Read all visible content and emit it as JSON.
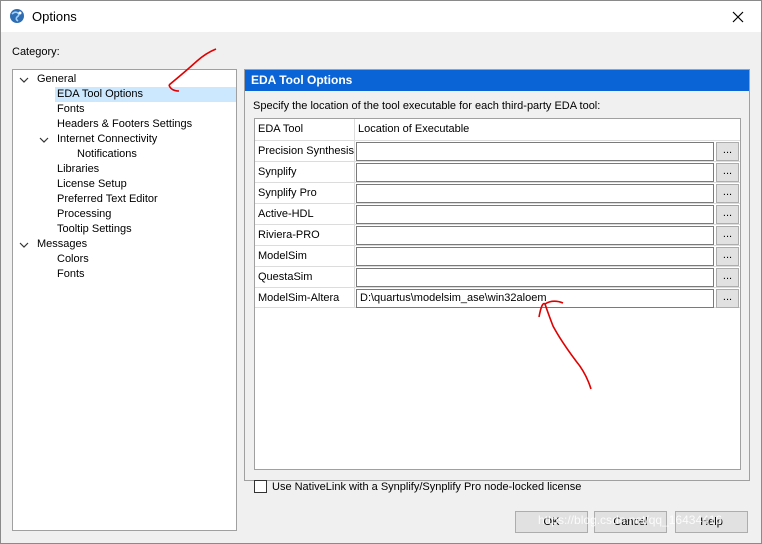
{
  "window": {
    "title": "Options"
  },
  "category_label": "Category:",
  "tree": {
    "items": [
      {
        "label": "General",
        "expanded": true
      },
      {
        "label": "EDA Tool Options",
        "selected": true
      },
      {
        "label": "Fonts"
      },
      {
        "label": "Headers & Footers Settings"
      },
      {
        "label": "Internet Connectivity",
        "expanded": true
      },
      {
        "label": "Notifications"
      },
      {
        "label": "Libraries"
      },
      {
        "label": "License Setup"
      },
      {
        "label": "Preferred Text Editor"
      },
      {
        "label": "Processing"
      },
      {
        "label": "Tooltip Settings"
      },
      {
        "label": "Messages",
        "expanded": true
      },
      {
        "label": "Colors"
      },
      {
        "label": "Fonts"
      }
    ]
  },
  "panel": {
    "header": "EDA Tool Options",
    "description": "Specify the location of the tool executable for each third-party EDA tool:",
    "columns": [
      "EDA Tool",
      "Location of Executable"
    ],
    "rows": [
      {
        "tool": "Precision Synthesis",
        "path": ""
      },
      {
        "tool": "Synplify",
        "path": ""
      },
      {
        "tool": "Synplify Pro",
        "path": ""
      },
      {
        "tool": "Active-HDL",
        "path": ""
      },
      {
        "tool": "Riviera-PRO",
        "path": ""
      },
      {
        "tool": "ModelSim",
        "path": ""
      },
      {
        "tool": "QuestaSim",
        "path": ""
      },
      {
        "tool": "ModelSim-Altera",
        "path": "D:\\quartus\\modelsim_ase\\win32aloem"
      }
    ],
    "browse_label": "..."
  },
  "nativelink": {
    "label": "Use NativeLink with a Synplify/Synplify Pro node-locked license",
    "checked": false
  },
  "buttons": {
    "ok": "OK",
    "cancel": "Cancel",
    "help": "Help"
  },
  "watermark": "https://blog.csdn.net/qq_16434416",
  "colors": {
    "accent": "#0a64d6",
    "selection": "#cce8ff",
    "annotation": "#e00000"
  }
}
